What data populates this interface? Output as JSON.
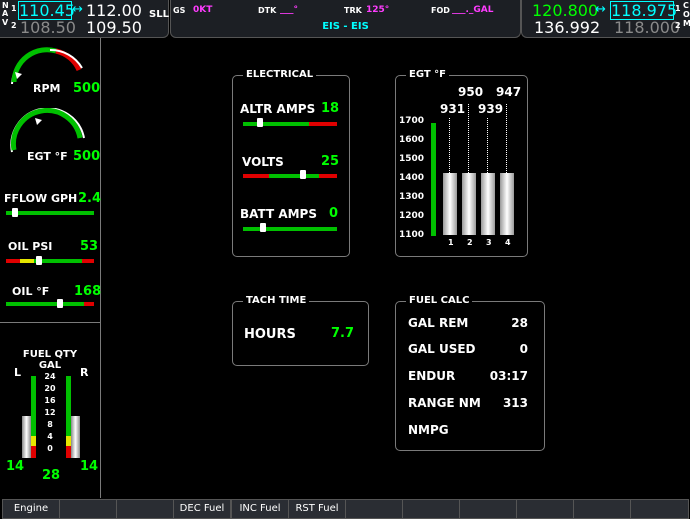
{
  "nav": {
    "n_label": "N",
    "a_label": "A",
    "v_label": "V",
    "idx1": "1",
    "idx2": "2",
    "active1": "110.45",
    "standby1": "112.00",
    "active2": "108.50",
    "standby2": "109.50",
    "ident": "SLL",
    "swap": "↔"
  },
  "com": {
    "c_label": "C",
    "o_label": "O",
    "m_label": "M",
    "idx1": "1",
    "idx2": "2",
    "active1": "120.800",
    "standby1": "118.975",
    "active2": "136.992",
    "standby2": "118.000",
    "swap": "↔"
  },
  "status": {
    "gs_label": "GS",
    "gs_value": "0KT",
    "dtk_label": "DTK",
    "dtk_value": "___°",
    "trk_label": "TRK",
    "trk_value": "125°",
    "fod_label": "FOD",
    "fod_value": "___._GAL",
    "page_title": "EIS - EIS"
  },
  "sidebar": {
    "rpm_label": "RPM",
    "rpm_value": "500",
    "egt_label": "EGT °F",
    "egt_value": "500",
    "fflow_label": "FFLOW GPH",
    "fflow_value": "2.4",
    "oilpsi_label": "OIL PSI",
    "oilpsi_value": "53",
    "oilf_label": "OIL °F",
    "oilf_value": "168",
    "fuel_title1": "FUEL QTY",
    "fuel_title2": "GAL",
    "fuel_l": "L",
    "fuel_r": "R",
    "fuel_ticks": [
      "24",
      "20",
      "16",
      "12",
      "8",
      "4",
      "0"
    ],
    "fuel_left_val": "14",
    "fuel_right_val": "14",
    "fuel_total": "28"
  },
  "electrical": {
    "title": "ELECTRICAL",
    "altr_label": "ALTR AMPS",
    "altr_value": "18",
    "volts_label": "VOLTS",
    "volts_value": "25",
    "batt_label": "BATT AMPS",
    "batt_value": "0"
  },
  "egt": {
    "title": "EGT °F",
    "scale": [
      "1700",
      "1600",
      "1500",
      "1400",
      "1300",
      "1200",
      "1100"
    ],
    "cyl_values": [
      "931",
      "950",
      "939",
      "947"
    ],
    "cyl_labels": [
      "1",
      "2",
      "3",
      "4"
    ]
  },
  "tach": {
    "title": "TACH TIME",
    "hours_label": "HOURS",
    "hours_value": "7.7"
  },
  "fuelcalc": {
    "title": "FUEL CALC",
    "rows": [
      {
        "label": "GAL REM",
        "value": "28"
      },
      {
        "label": "GAL USED",
        "value": "0"
      },
      {
        "label": "ENDUR",
        "value": "03:17"
      },
      {
        "label": "RANGE NM",
        "value": "313"
      },
      {
        "label": "NMPG",
        "value": ""
      }
    ]
  },
  "softkeys": [
    "Engine",
    "",
    "",
    "DEC Fuel",
    "INC Fuel",
    "RST Fuel",
    "",
    "",
    "",
    "",
    "",
    ""
  ]
}
